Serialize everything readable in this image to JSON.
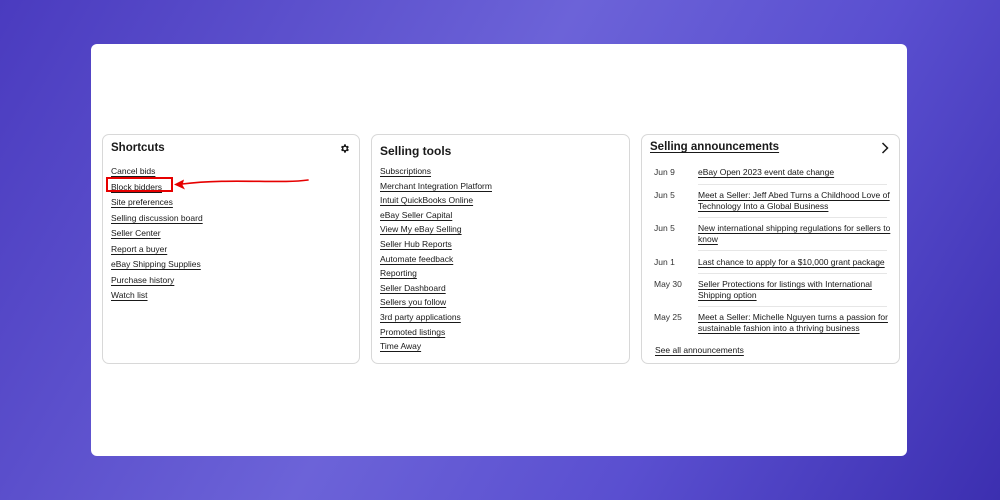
{
  "shortcuts": {
    "title": "Shortcuts",
    "items": [
      {
        "label": "Cancel bids"
      },
      {
        "label": "Block bidders"
      },
      {
        "label": "Site preferences"
      },
      {
        "label": "Selling discussion board"
      },
      {
        "label": "Seller Center"
      },
      {
        "label": "Report a buyer"
      },
      {
        "label": "eBay Shipping Supplies"
      },
      {
        "label": "Purchase history"
      },
      {
        "label": "Watch list"
      }
    ],
    "settings_icon": "gear-icon",
    "highlighted_item": "Block bidders",
    "highlight_color": "#e60000"
  },
  "selling_tools": {
    "title": "Selling tools",
    "items": [
      {
        "label": "Subscriptions"
      },
      {
        "label": "Merchant Integration Platform"
      },
      {
        "label": "Intuit QuickBooks Online"
      },
      {
        "label": "eBay Seller Capital"
      },
      {
        "label": "View My eBay Selling"
      },
      {
        "label": "Seller Hub Reports"
      },
      {
        "label": "Automate feedback"
      },
      {
        "label": "Reporting"
      },
      {
        "label": "Seller Dashboard"
      },
      {
        "label": "Sellers you follow"
      },
      {
        "label": "3rd party applications"
      },
      {
        "label": "Promoted listings"
      },
      {
        "label": "Time Away"
      }
    ]
  },
  "announcements": {
    "title": "Selling announcements",
    "chevron_icon": "chevron-right-icon",
    "items": [
      {
        "date": "Jun 9",
        "title": "eBay Open 2023 event date change"
      },
      {
        "date": "Jun 5",
        "title": "Meet a Seller: Jeff Abed Turns a Childhood Love of Technology Into a Global Business"
      },
      {
        "date": "Jun 5",
        "title": "New international shipping regulations for sellers to know"
      },
      {
        "date": "Jun 1",
        "title": "Last chance to apply for a $10,000 grant package"
      },
      {
        "date": "May 30",
        "title": "Seller Protections for listings with International Shipping option"
      },
      {
        "date": "May 25",
        "title": "Meet a Seller: Michelle Nguyen turns a passion for sustainable fashion into a thriving business"
      }
    ],
    "see_all": "See all announcements"
  }
}
